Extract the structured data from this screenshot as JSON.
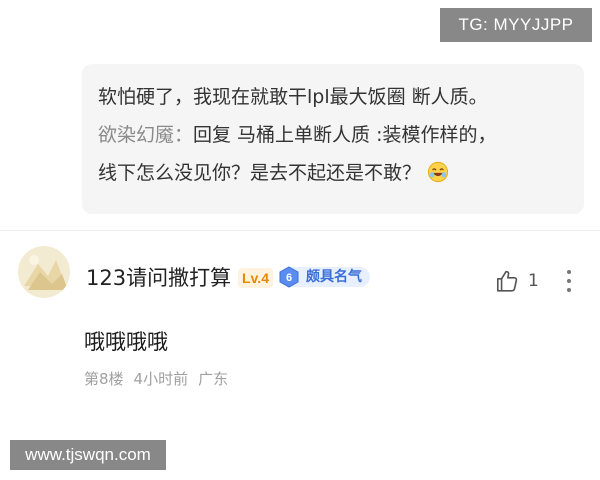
{
  "watermarks": {
    "top": "TG: MYYJJPP",
    "bottom": "www.tjswqn.com"
  },
  "quote": {
    "line1": "软怕硬了，我现在就敢干lpl最大饭圈 断人质。",
    "author": "欲染幻魇：",
    "line2_text": "回复 马桶上单断人质 :装模作样的，",
    "line3": "线下怎么没见你？是去不起还是不敢？",
    "emoji": "laughing-face-emoji"
  },
  "comment": {
    "username": "123请问撒打算",
    "level": "Lv.4",
    "fame_number": "6",
    "fame_label": "颇具名气",
    "like_count": "1",
    "body": "哦哦哦哦",
    "floor": "第8楼",
    "time": "4小时前",
    "location": "广东"
  },
  "colors": {
    "quote_bg": "#f5f5f6",
    "level_text": "#e48a00",
    "fame_text": "#3a6fd8",
    "meta_text": "#a0a0a0"
  }
}
